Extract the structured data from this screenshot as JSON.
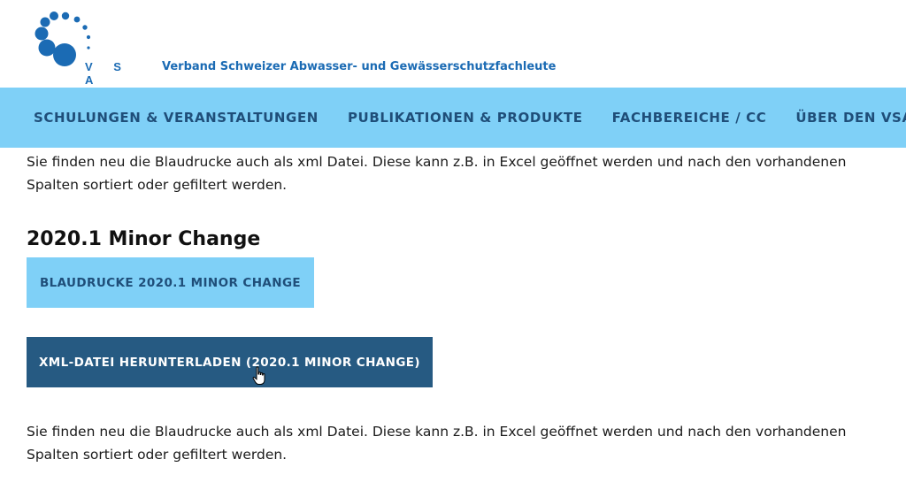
{
  "header": {
    "logo_letters": "V S A",
    "org_name": "Verband Schweizer Abwasser- und Gewässerschutzfachleute"
  },
  "nav": {
    "items": [
      "SCHULUNGEN & VERANSTALTUNGEN",
      "PUBLIKATIONEN & PRODUKTE",
      "FACHBEREICHE / CC",
      "ÜBER DEN VSA"
    ]
  },
  "content": {
    "intro_paragraph": "Sie finden neu die Blaudrucke auch als xml Datei. Diese kann z.B. in Excel geöffnet werden und nach den vorhandenen Spalten sortiert oder gefiltert werden.",
    "section_heading": "2020.1 Minor Change",
    "button_blaudrucke": "BLAUDRUCKE 2020.1 MINOR CHANGE",
    "button_xml": "XML-DATEI HERUNTERLADEN (2020.1 MINOR CHANGE)",
    "outro_paragraph": "Sie finden neu die Blaudrucke auch als xml Datei. Diese kann z.B. in Excel geöffnet werden und nach den vorhandenen Spalten sortiert oder gefiltert werden."
  },
  "colors": {
    "brand_blue": "#1b6bb4",
    "nav_background": "#7fd0f7",
    "nav_text": "#1f4e79",
    "dark_button": "#265a82"
  },
  "icons": {
    "logo": "vsa-dots-logo",
    "cursor": "hand-pointer-icon"
  }
}
